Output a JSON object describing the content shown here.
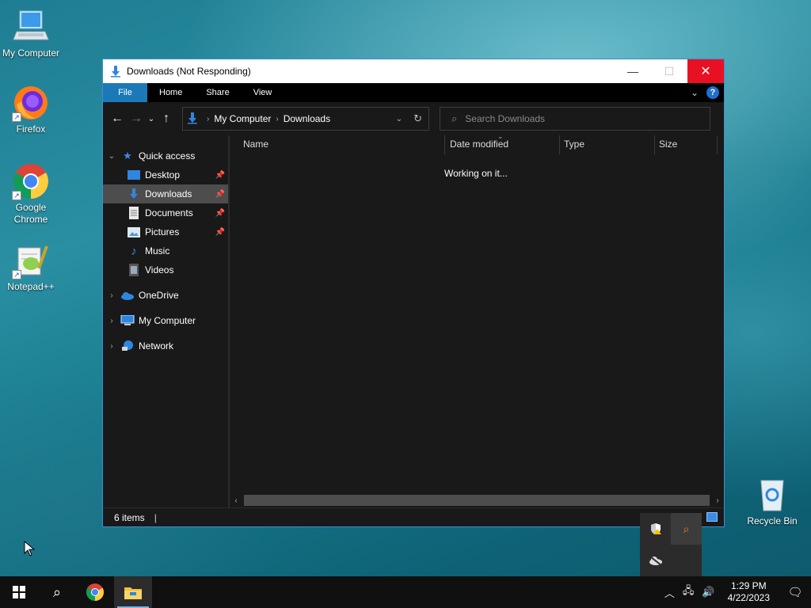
{
  "desktop": {
    "icons": [
      {
        "label": "My Computer"
      },
      {
        "label": "Firefox"
      },
      {
        "label": "Google Chrome"
      },
      {
        "label": "Notepad++"
      },
      {
        "label": "Recycle Bin"
      }
    ]
  },
  "window": {
    "title": "Downloads (Not Responding)",
    "ribbon_tabs": [
      "File",
      "Home",
      "Share",
      "View"
    ],
    "help_label": "?",
    "address": {
      "crumbs": [
        "My Computer",
        "Downloads"
      ]
    },
    "search": {
      "placeholder": "Search Downloads"
    },
    "sidebar": {
      "quick_access": "Quick access",
      "items": [
        {
          "label": "Desktop",
          "pinned": true
        },
        {
          "label": "Downloads",
          "pinned": true,
          "selected": true
        },
        {
          "label": "Documents",
          "pinned": true
        },
        {
          "label": "Pictures",
          "pinned": true
        },
        {
          "label": "Music",
          "pinned": false
        },
        {
          "label": "Videos",
          "pinned": false
        }
      ],
      "roots": [
        {
          "label": "OneDrive"
        },
        {
          "label": "My Computer"
        },
        {
          "label": "Network"
        }
      ]
    },
    "columns": [
      "Name",
      "Date modified",
      "Type",
      "Size"
    ],
    "content_message": "Working on it...",
    "status": {
      "item_count": "6 items"
    }
  },
  "taskbar": {
    "clock_time": "1:29 PM",
    "clock_date": "4/22/2023"
  },
  "colors": {
    "accent": "#1b79b8",
    "close": "#e81123",
    "window_bg": "#191919"
  }
}
